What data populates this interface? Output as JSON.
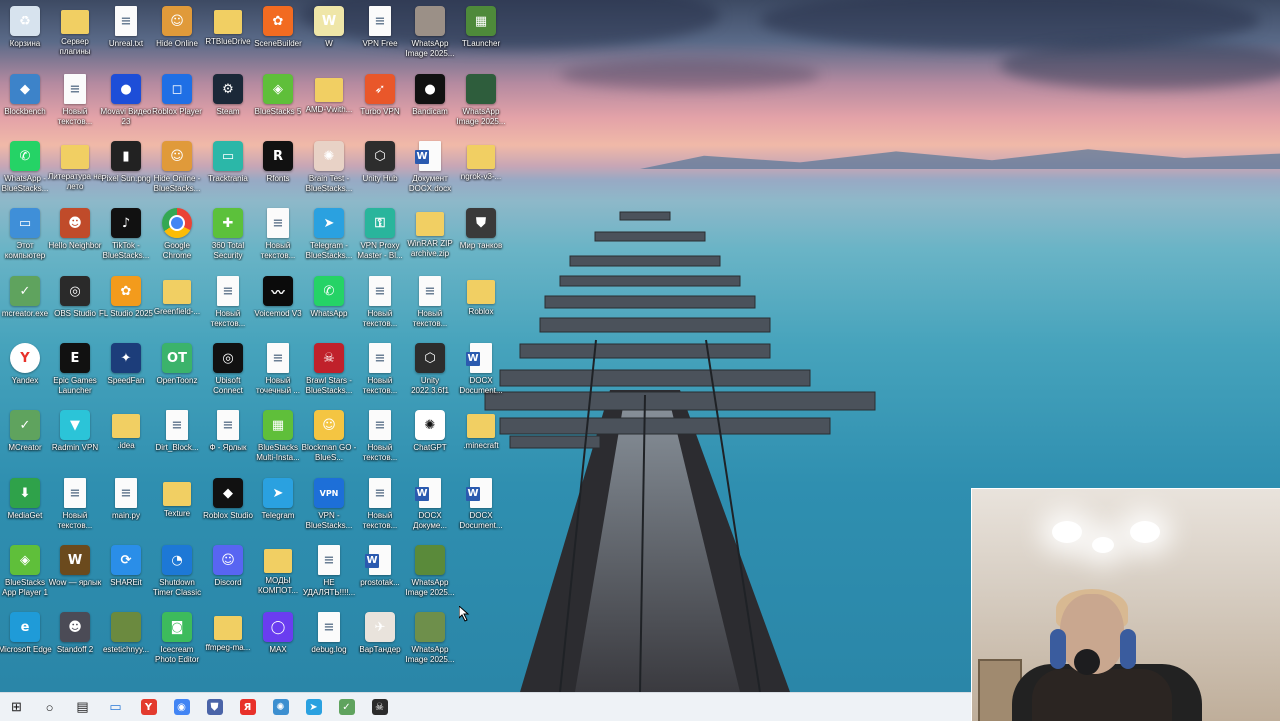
{
  "desktop": {
    "icons": [
      {
        "label": "Корзина",
        "color": "#d7e3ee",
        "glyph": "♻",
        "type": "app"
      },
      {
        "label": "Сервер плагины",
        "color": "",
        "glyph": "",
        "type": "folder"
      },
      {
        "label": "Unreal.txt",
        "color": "",
        "glyph": "",
        "type": "doc"
      },
      {
        "label": "Hide Online",
        "color": "#e09a3a",
        "glyph": "☺",
        "type": "app"
      },
      {
        "label": "RTBlueDrive",
        "color": "",
        "glyph": "",
        "type": "folder"
      },
      {
        "label": "SceneBuilder",
        "color": "#f26b21",
        "glyph": "✿",
        "type": "app"
      },
      {
        "label": "W",
        "color": "#efe6a8",
        "glyph": "W",
        "type": "app"
      },
      {
        "label": "VPN Free",
        "color": "",
        "glyph": "",
        "type": "doc"
      },
      {
        "label": "WhatsApp Image 2025...",
        "color": "#9b9087",
        "glyph": "",
        "type": "app"
      },
      {
        "label": "TLauncher",
        "color": "#4e8a3a",
        "glyph": "▦",
        "type": "app"
      },
      {
        "label": "Blockbench",
        "color": "#3d83c9",
        "glyph": "◆",
        "type": "app"
      },
      {
        "label": "Новый текстов...",
        "color": "",
        "glyph": "",
        "type": "doc"
      },
      {
        "label": "Movavi Видео 23",
        "color": "#1d4ed8",
        "glyph": "●",
        "type": "app"
      },
      {
        "label": "Roblox Player",
        "color": "#1f6fe5",
        "glyph": "◻",
        "type": "app"
      },
      {
        "label": "Steam",
        "color": "#1b2838",
        "glyph": "⚙",
        "type": "app"
      },
      {
        "label": "BlueStacks 5",
        "color": "#5fbf3a",
        "glyph": "◈",
        "type": "app"
      },
      {
        "label": "AMD-Vwith...",
        "color": "",
        "glyph": "",
        "type": "folder"
      },
      {
        "label": "Turbo VPN",
        "color": "#e9572a",
        "glyph": "➶",
        "type": "app"
      },
      {
        "label": "Bandicam",
        "color": "#111111",
        "glyph": "●",
        "type": "app"
      },
      {
        "label": "WhatsApp Image 2025...",
        "color": "#2e5d3c",
        "glyph": "",
        "type": "app"
      },
      {
        "label": "WhatsApp - BlueStacks...",
        "color": "#25d366",
        "glyph": "✆",
        "type": "app"
      },
      {
        "label": "Литература на лето",
        "color": "",
        "glyph": "",
        "type": "folder"
      },
      {
        "label": "Pixel Sun.png",
        "color": "#222",
        "glyph": "▮",
        "type": "app"
      },
      {
        "label": "Hide Online - BlueStacks...",
        "color": "#e09a3a",
        "glyph": "☺",
        "type": "app"
      },
      {
        "label": "Tracktrania",
        "color": "#2bb7a8",
        "glyph": "▭",
        "type": "app"
      },
      {
        "label": "Rfonts",
        "color": "#111",
        "glyph": "R",
        "type": "app"
      },
      {
        "label": "Brain Test - BlueStacks...",
        "color": "#e8d2c6",
        "glyph": "✺",
        "type": "app"
      },
      {
        "label": "Unity Hub",
        "color": "#2d2d2d",
        "glyph": "⬡",
        "type": "app"
      },
      {
        "label": "Документ DOCX.docx",
        "color": "",
        "glyph": "",
        "type": "word"
      },
      {
        "label": "ngrok-v3-...",
        "color": "",
        "glyph": "",
        "type": "folder"
      },
      {
        "label": "Этот компьютер",
        "color": "#3f8fd8",
        "glyph": "▭",
        "type": "app"
      },
      {
        "label": "Hello Neighbor",
        "color": "#c04b2a",
        "glyph": "☻",
        "type": "app"
      },
      {
        "label": "TikTok - BlueStacks...",
        "color": "#111",
        "glyph": "♪",
        "type": "app"
      },
      {
        "label": "Google Chrome",
        "color": "#ffffff",
        "glyph": "◉",
        "type": "chrome"
      },
      {
        "label": "360 Total Security",
        "color": "#5cc13b",
        "glyph": "✚",
        "type": "app"
      },
      {
        "label": "Новый текстов...",
        "color": "",
        "glyph": "",
        "type": "doc"
      },
      {
        "label": "Telegram - BlueStacks...",
        "color": "#2aa1e0",
        "glyph": "➤",
        "type": "app"
      },
      {
        "label": "VPN Proxy Master - Bl...",
        "color": "#29b59c",
        "glyph": "⚿",
        "type": "app"
      },
      {
        "label": "WinRAR ZIP archive.zip",
        "color": "",
        "glyph": "",
        "type": "folder"
      },
      {
        "label": "Мир танков",
        "color": "#3a3a3a",
        "glyph": "⛊",
        "type": "app"
      },
      {
        "label": "mcreator.exe",
        "color": "#5fa35e",
        "glyph": "✓",
        "type": "app"
      },
      {
        "label": "OBS Studio",
        "color": "#2a2a2a",
        "glyph": "◎",
        "type": "app"
      },
      {
        "label": "FL Studio 2025",
        "color": "#f39b1c",
        "glyph": "✿",
        "type": "app"
      },
      {
        "label": "Greenfield-...",
        "color": "",
        "glyph": "",
        "type": "folder"
      },
      {
        "label": "Новый текстов...",
        "color": "",
        "glyph": "",
        "type": "doc"
      },
      {
        "label": "Voicemod V3",
        "color": "#0b0b0b",
        "glyph": "〰",
        "type": "app"
      },
      {
        "label": "WhatsApp",
        "color": "#25d366",
        "glyph": "✆",
        "type": "app"
      },
      {
        "label": "Новый текстов...",
        "color": "",
        "glyph": "",
        "type": "doc"
      },
      {
        "label": "Новый текстов...",
        "color": "",
        "glyph": "",
        "type": "doc"
      },
      {
        "label": "Roblox",
        "color": "",
        "glyph": "",
        "type": "folder"
      },
      {
        "label": "Yandex",
        "color": "#ffffff",
        "glyph": "Y",
        "type": "yandex"
      },
      {
        "label": "Epic Games Launcher",
        "color": "#111",
        "glyph": "E",
        "type": "app"
      },
      {
        "label": "SpeedFan",
        "color": "#1c3d7a",
        "glyph": "✦",
        "type": "app"
      },
      {
        "label": "OpenToonz",
        "color": "#3bb36b",
        "glyph": "OT",
        "type": "app"
      },
      {
        "label": "Ubisoft Connect",
        "color": "#111",
        "glyph": "◎",
        "type": "app"
      },
      {
        "label": "Новый точечный ...",
        "color": "",
        "glyph": "",
        "type": "doc"
      },
      {
        "label": "Brawl Stars - BlueStacks...",
        "color": "#c0212b",
        "glyph": "☠",
        "type": "app"
      },
      {
        "label": "Новый текстов...",
        "color": "",
        "glyph": "",
        "type": "doc"
      },
      {
        "label": "Unity 2022.3.6f1",
        "color": "#2d2d2d",
        "glyph": "⬡",
        "type": "app"
      },
      {
        "label": "DOCX Document...",
        "color": "",
        "glyph": "",
        "type": "word"
      },
      {
        "label": "MCreator",
        "color": "#5fa35e",
        "glyph": "✓",
        "type": "app"
      },
      {
        "label": "Radmin VPN",
        "color": "#2bc4d8",
        "glyph": "▼",
        "type": "app"
      },
      {
        "label": ".idea",
        "color": "",
        "glyph": "",
        "type": "folder"
      },
      {
        "label": "Dirt_Block...",
        "color": "",
        "glyph": "",
        "type": "doc"
      },
      {
        "label": "Ф - Ярлык",
        "color": "",
        "glyph": "",
        "type": "doc"
      },
      {
        "label": "BlueStacks Multi-Insta...",
        "color": "#5fbf3a",
        "glyph": "▦",
        "type": "app"
      },
      {
        "label": "Blockman GO - BlueS...",
        "color": "#f4c542",
        "glyph": "☺",
        "type": "app"
      },
      {
        "label": "Новый текстов...",
        "color": "",
        "glyph": "",
        "type": "doc"
      },
      {
        "label": "ChatGPT",
        "color": "#ffffff",
        "glyph": "✺",
        "type": "chatgpt"
      },
      {
        "label": ".minecraft",
        "color": "",
        "glyph": "",
        "type": "folder"
      },
      {
        "label": "MediaGet",
        "color": "#2fa24a",
        "glyph": "⬇",
        "type": "app"
      },
      {
        "label": "Новый текстов...",
        "color": "",
        "glyph": "",
        "type": "doc"
      },
      {
        "label": "main.py",
        "color": "",
        "glyph": "",
        "type": "doc"
      },
      {
        "label": "Texture",
        "color": "",
        "glyph": "",
        "type": "folder"
      },
      {
        "label": "Roblox Studio",
        "color": "#111",
        "glyph": "◆",
        "type": "app"
      },
      {
        "label": "Telegram",
        "color": "#2aa1e0",
        "glyph": "➤",
        "type": "app"
      },
      {
        "label": "VPN - BlueStacks...",
        "color": "#1d6fd8",
        "glyph": "VPN",
        "type": "app"
      },
      {
        "label": "Новый текстов...",
        "color": "",
        "glyph": "",
        "type": "doc"
      },
      {
        "label": "DOCX Докуме...",
        "color": "",
        "glyph": "",
        "type": "word"
      },
      {
        "label": "DOCX Document...",
        "color": "",
        "glyph": "",
        "type": "word"
      },
      {
        "label": "BlueStacks App Player 1",
        "color": "#5fbf3a",
        "glyph": "◈",
        "type": "app"
      },
      {
        "label": "Wow — ярлык",
        "color": "#6b4a1d",
        "glyph": "W",
        "type": "app"
      },
      {
        "label": "SHAREit",
        "color": "#2a8ee8",
        "glyph": "⟳",
        "type": "app"
      },
      {
        "label": "Shutdown Timer Classic",
        "color": "#1d78d6",
        "glyph": "◔",
        "type": "app"
      },
      {
        "label": "Discord",
        "color": "#5865f2",
        "glyph": "☺",
        "type": "app"
      },
      {
        "label": "МОДЫ КОМПОТ...",
        "color": "",
        "glyph": "",
        "type": "folder"
      },
      {
        "label": "НЕ УДАЛЯТЬ!!!!...",
        "color": "",
        "glyph": "",
        "type": "doc"
      },
      {
        "label": "prostotak...",
        "color": "",
        "glyph": "",
        "type": "word"
      },
      {
        "label": "WhatsApp Image 2025...",
        "color": "#5a8a3a",
        "glyph": "",
        "type": "app"
      },
      {
        "label": "",
        "color": "",
        "glyph": "",
        "type": "none"
      },
      {
        "label": "Microsoft Edge",
        "color": "#1f9bd8",
        "glyph": "e",
        "type": "app"
      },
      {
        "label": "Standoff 2",
        "color": "#4b4b56",
        "glyph": "☻",
        "type": "app"
      },
      {
        "label": "estetichnyy...",
        "color": "#6b8a3f",
        "glyph": "",
        "type": "app"
      },
      {
        "label": "Icecream Photo Editor",
        "color": "#3dbb5c",
        "glyph": "◙",
        "type": "app"
      },
      {
        "label": "ffmpeg-ma...",
        "color": "",
        "glyph": "",
        "type": "folder"
      },
      {
        "label": "MAX",
        "color": "#6a3df0",
        "glyph": "◯",
        "type": "app"
      },
      {
        "label": "debug.log",
        "color": "",
        "glyph": "",
        "type": "doc"
      },
      {
        "label": "ВарТандер",
        "color": "#e9e3dc",
        "glyph": "✈",
        "type": "app"
      },
      {
        "label": "WhatsApp Image 2025...",
        "color": "#6e8f4b",
        "glyph": "",
        "type": "app"
      },
      {
        "label": "",
        "color": "",
        "glyph": "",
        "type": "none"
      }
    ]
  },
  "taskbar": {
    "items": [
      {
        "name": "windows-start-icon",
        "glyph": "⊞",
        "color": "#1a1a1a",
        "bg": ""
      },
      {
        "name": "search-icon",
        "glyph": "○",
        "color": "#1a1a1a",
        "bg": ""
      },
      {
        "name": "task-view-icon",
        "glyph": "▤",
        "color": "#1a1a1a",
        "bg": ""
      },
      {
        "name": "file-explorer-icon",
        "glyph": "▭",
        "color": "#2a78d6",
        "bg": ""
      },
      {
        "name": "yandex-browser-icon",
        "glyph": "Y",
        "color": "#ffffff",
        "bg": "#e33b2e"
      },
      {
        "name": "chrome-icon",
        "glyph": "◉",
        "color": "#ffffff",
        "bg": "#4285f4"
      },
      {
        "name": "shield-app-icon",
        "glyph": "⛊",
        "color": "#ffffff",
        "bg": "#4a64a8"
      },
      {
        "name": "yandex-icon",
        "glyph": "Я",
        "color": "#ffffff",
        "bg": "#e8312a"
      },
      {
        "name": "steam-like-icon",
        "glyph": "✺",
        "color": "#ffffff",
        "bg": "#3c8fd0"
      },
      {
        "name": "telegram-icon",
        "glyph": "➤",
        "color": "#ffffff",
        "bg": "#2aa1e0"
      },
      {
        "name": "mcreator-taskbar-icon",
        "glyph": "✓",
        "color": "#ffffff",
        "bg": "#5fa35e"
      },
      {
        "name": "brawl-app-icon",
        "glyph": "☠",
        "color": "#ffffff",
        "bg": "#2b2b2b"
      }
    ]
  }
}
